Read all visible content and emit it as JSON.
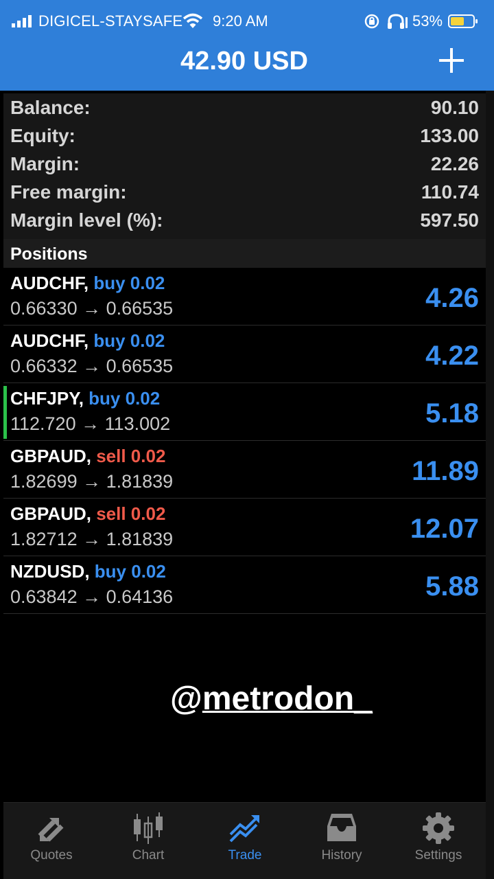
{
  "status_bar": {
    "carrier": "DIGICEL-STAYSAFE",
    "time": "9:20 AM",
    "battery_percent": "53%"
  },
  "header": {
    "title": "42.90 USD",
    "add_icon": "plus-icon"
  },
  "account": {
    "rows": [
      {
        "label": "Balance:",
        "value": "90.10"
      },
      {
        "label": "Equity:",
        "value": "133.00"
      },
      {
        "label": "Margin:",
        "value": "22.26"
      },
      {
        "label": "Free margin:",
        "value": "110.74"
      },
      {
        "label": "Margin level (%):",
        "value": "597.50"
      }
    ]
  },
  "positions": {
    "header": "Positions",
    "items": [
      {
        "symbol": "AUDCHF,",
        "direction": "buy 0.02",
        "type": "buy",
        "prices": "0.66330 → 0.66535",
        "profit": "4.26"
      },
      {
        "symbol": "AUDCHF,",
        "direction": "buy 0.02",
        "type": "buy",
        "prices": "0.66332 → 0.66535",
        "profit": "4.22"
      },
      {
        "symbol": "CHFJPY,",
        "direction": "buy 0.02",
        "type": "buy",
        "prices": "112.720 → 113.002",
        "profit": "5.18"
      },
      {
        "symbol": "GBPAUD,",
        "direction": "sell 0.02",
        "type": "sell",
        "prices": "1.82699 → 1.81839",
        "profit": "11.89"
      },
      {
        "symbol": "GBPAUD,",
        "direction": "sell 0.02",
        "type": "sell",
        "prices": "1.82712 → 1.81839",
        "profit": "12.07"
      },
      {
        "symbol": "NZDUSD,",
        "direction": "buy 0.02",
        "type": "buy",
        "prices": "0.63842 → 0.64136",
        "profit": "5.88"
      }
    ]
  },
  "watermark": {
    "at": "@",
    "handle": "metrodon_"
  },
  "tabs": [
    {
      "label": "Quotes",
      "icon": "quotes-arrows-icon"
    },
    {
      "label": "Chart",
      "icon": "candlestick-chart-icon"
    },
    {
      "label": "Trade",
      "icon": "trade-trend-icon",
      "active": true
    },
    {
      "label": "History",
      "icon": "inbox-tray-icon"
    },
    {
      "label": "Settings",
      "icon": "gear-icon"
    }
  ],
  "colors": {
    "header_blue": "#2f7fd9",
    "buy_blue": "#3a8ff0",
    "sell_red": "#f05a4a",
    "active_marker_green": "#2bc14a"
  }
}
